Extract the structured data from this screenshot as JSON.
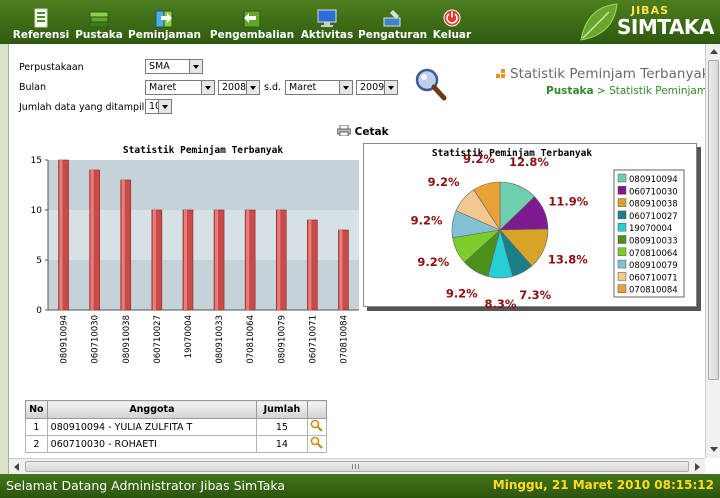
{
  "nav": [
    {
      "label": "Referensi",
      "icon": "reference-icon"
    },
    {
      "label": "Pustaka",
      "icon": "books-icon"
    },
    {
      "label": "Peminjaman",
      "icon": "borrow-icon"
    },
    {
      "label": "Pengembalian",
      "icon": "return-icon"
    },
    {
      "label": "Aktivitas",
      "icon": "monitor-icon"
    },
    {
      "label": "Pengaturan",
      "icon": "settings-icon"
    },
    {
      "label": "Keluar",
      "icon": "power-icon"
    }
  ],
  "logo": {
    "top": "JIBAS",
    "main": "SIMTAKA"
  },
  "form": {
    "perpustakaan_label": "Perpustakaan",
    "perpustakaan_value": "SMA",
    "bulan_label": "Bulan",
    "month_from": "Maret",
    "year_from": "2008",
    "sd_label": "s.d.",
    "month_to": "Maret",
    "year_to": "2009",
    "jumlah_label": "Jumlah data yang ditampilkan",
    "jumlah_value": "10"
  },
  "header": {
    "title": "Statistik Peminjam Terbanyak",
    "breadcrumb_root": "Pustaka",
    "breadcrumb_sep": " > ",
    "breadcrumb_current": "Statistik Peminjam"
  },
  "cetak_label": "Cetak",
  "chart_data": [
    {
      "type": "bar",
      "title": "Statistik Peminjam Terbanyak",
      "categories": [
        "080910094",
        "060710030",
        "080910038",
        "060710027",
        "19070004",
        "080910033",
        "070810064",
        "080910079",
        "060710071",
        "070810084"
      ],
      "values": [
        15,
        14,
        13,
        10,
        10,
        10,
        10,
        10,
        9,
        8
      ],
      "ylim": [
        0,
        15
      ],
      "yticks": [
        0,
        5,
        10,
        15
      ],
      "bar_color": "#c94a48",
      "plot_bg_bands": [
        "#c5d3d8",
        "#d6e1e5"
      ]
    },
    {
      "type": "pie",
      "title": "Statistik Peminjam Terbanyak",
      "labels": [
        "080910094",
        "060710030",
        "080910038",
        "060710027",
        "19070004",
        "080910033",
        "070810064",
        "080910079",
        "060710071",
        "070810084"
      ],
      "values": [
        12.8,
        11.9,
        13.8,
        7.3,
        8.3,
        9.2,
        9.2,
        9.2,
        9.2,
        9.2
      ],
      "value_labels": [
        "12.8%",
        "11.9%",
        "13.8%",
        "7.3%",
        "8.3%",
        "9.2%",
        "9.2%",
        "9.2%",
        "9.2%",
        "9.2%"
      ],
      "colors": [
        "#6ecfae",
        "#7d1a8f",
        "#d8a428",
        "#1a7f86",
        "#25cfd8",
        "#4d8f1b",
        "#7ccd2a",
        "#82c0d4",
        "#f3c890",
        "#e8a238"
      ],
      "legend_placement": "right"
    }
  ],
  "table": {
    "headers": [
      "No",
      "Anggota",
      "Jumlah",
      ""
    ],
    "rows": [
      {
        "no": "1",
        "anggota": "080910094 - YULIA ZULFITA T",
        "jumlah": "15"
      },
      {
        "no": "2",
        "anggota": "060710030 - ROHAETI",
        "jumlah": "14"
      }
    ]
  },
  "status": {
    "welcome": "Selamat Datang Administrator Jibas SimTaka",
    "datetime": "Minggu, 21 Maret 2010 08:15:12"
  }
}
